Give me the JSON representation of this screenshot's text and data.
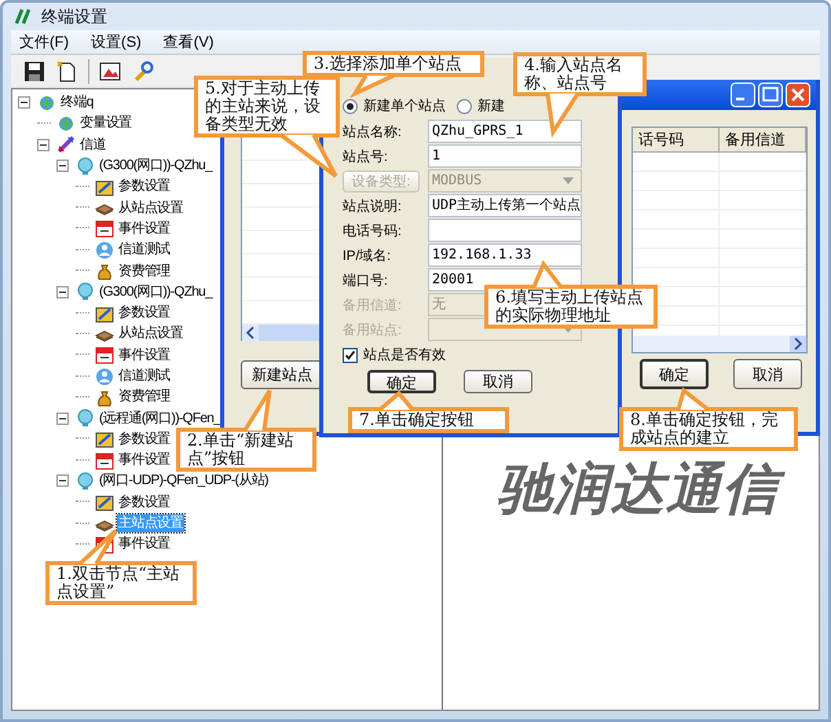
{
  "window": {
    "title": "终端设置"
  },
  "menu": [
    "文件(F)",
    "设置(S)",
    "查看(V)"
  ],
  "toolbar": [
    {
      "kind": "save"
    },
    {
      "kind": "new"
    },
    {
      "kind": "image"
    },
    {
      "kind": "tool"
    }
  ],
  "tree": [
    {
      "label": "终端q",
      "kind": "globe",
      "expanded": true,
      "selected": false,
      "children": [
        {
          "label": "变量设置",
          "kind": "globe",
          "selected": false
        },
        {
          "label": "信道",
          "kind": "arrows",
          "expanded": true,
          "selected": false,
          "children": [
            {
              "label": "(G300(网口))-QZhu_",
              "kind": "device",
              "expanded": true,
              "selected": false,
              "children": [
                {
                  "label": "参数设置",
                  "kind": "param",
                  "selected": false
                },
                {
                  "label": "从站点设置",
                  "kind": "book",
                  "selected": false
                },
                {
                  "label": "事件设置",
                  "kind": "calendar",
                  "selected": false
                },
                {
                  "label": "信道测试",
                  "kind": "person",
                  "selected": false
                },
                {
                  "label": "资费管理",
                  "kind": "fee",
                  "selected": false
                }
              ]
            },
            {
              "label": "(G300(网口))-QZhu_",
              "kind": "device",
              "expanded": true,
              "selected": false,
              "children": [
                {
                  "label": "参数设置",
                  "kind": "param",
                  "selected": false
                },
                {
                  "label": "从站点设置",
                  "kind": "book",
                  "selected": false
                },
                {
                  "label": "事件设置",
                  "kind": "calendar",
                  "selected": false
                },
                {
                  "label": "信道测试",
                  "kind": "person",
                  "selected": false
                },
                {
                  "label": "资费管理",
                  "kind": "fee",
                  "selected": false
                }
              ]
            },
            {
              "label": "(远程通(网口))-QFen_",
              "kind": "device",
              "expanded": true,
              "selected": false,
              "children": [
                {
                  "label": "参数设置",
                  "kind": "param",
                  "selected": false
                },
                {
                  "label": "事件设置",
                  "kind": "calendar",
                  "selected": false
                }
              ]
            },
            {
              "label": "(网口-UDP)-QFen_UDP-(从站)",
              "kind": "device",
              "expanded": true,
              "selected": false,
              "children": [
                {
                  "label": "参数设置",
                  "kind": "param",
                  "selected": false
                },
                {
                  "label": "主站点设置",
                  "kind": "book",
                  "selected": true
                },
                {
                  "label": "事件设置",
                  "kind": "calendar",
                  "selected": false
                }
              ]
            }
          ]
        }
      ]
    }
  ],
  "logo": "驰润达通信",
  "station_list_dialog": {
    "new_button": "新建站点",
    "columns": [
      "话号码",
      "备用信道"
    ],
    "buttons": [
      "确定",
      "取消"
    ]
  },
  "station_dialog": {
    "radios": [
      {
        "label": "新建单个站点",
        "selected": true
      },
      {
        "label": "新建",
        "selected": false
      }
    ],
    "fields": [
      {
        "kind": "text",
        "label": "站点名称:",
        "value": "QZhu_GPRS_1",
        "disabled": false
      },
      {
        "kind": "text",
        "label": "站点号:",
        "value": "1",
        "disabled": false
      },
      {
        "kind": "combo",
        "label": "设备类型:",
        "value": "MODBUS",
        "disabled": true
      },
      {
        "kind": "text",
        "label": "站点说明:",
        "value": "UDP主动上传第一个站点",
        "disabled": false
      },
      {
        "kind": "text",
        "label": "电话号码:",
        "disabled": false
      },
      {
        "kind": "text",
        "label": "IP/域名:",
        "value": "192.168.1.33",
        "disabled": false
      },
      {
        "kind": "text",
        "label": "端口号:",
        "value": "20001",
        "disabled": false
      },
      {
        "kind": "combo",
        "label": "备用信道:",
        "value": "无",
        "disabled": true
      },
      {
        "kind": "combo",
        "label": "备用站点:",
        "disabled": true
      }
    ],
    "valid_checkbox": {
      "label": "站点是否有效",
      "checked": true
    },
    "buttons": [
      "确定",
      "取消"
    ]
  },
  "callouts": [
    "1.双击节点“主站点设置”",
    "2.单击“新建站点”按钮",
    "3.选择添加单个站点",
    "4.输入站点名称、站点号",
    "5.对于主动上传的主站来说，设备类型无效",
    "6.填写主动上传站点的实际物理地址",
    "7.单击确定按钮",
    "8.单击确定按钮，完成站点的建立"
  ]
}
